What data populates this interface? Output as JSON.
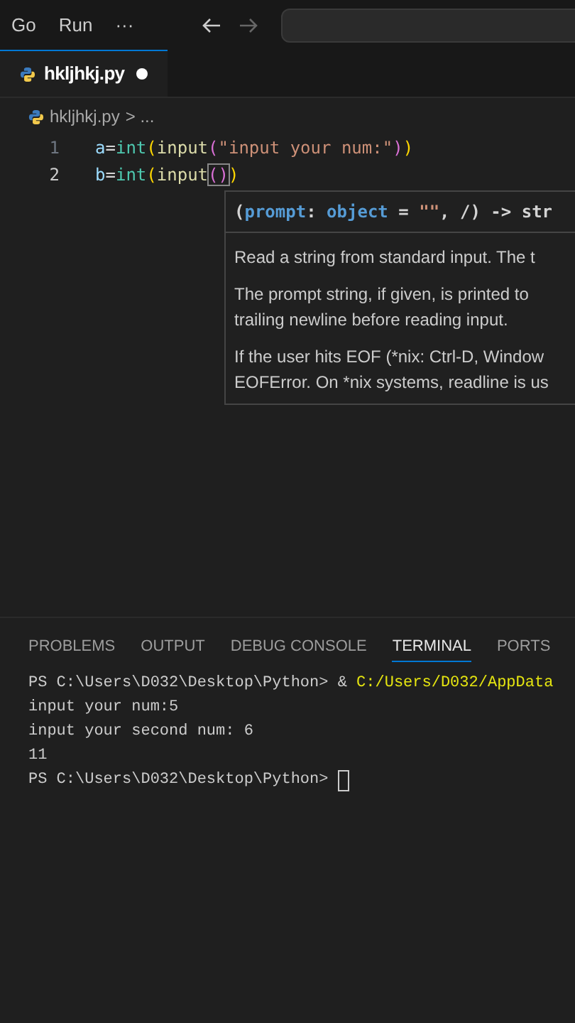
{
  "menu": [
    {
      "label": "Go"
    },
    {
      "label": "Run"
    },
    {
      "label": "···"
    }
  ],
  "tab": {
    "label": "hkljhkj.py",
    "modified": true
  },
  "breadcrumb": {
    "file": "hkljhkj.py",
    "rest": "> ..."
  },
  "code_lines": [
    {
      "number": "1",
      "tokens": [
        {
          "kind": "var",
          "text": "a"
        },
        {
          "kind": "op",
          "text": "="
        },
        {
          "kind": "builtin",
          "text": "int"
        },
        {
          "kind": "paren1",
          "text": "("
        },
        {
          "kind": "func",
          "text": "input"
        },
        {
          "kind": "paren2",
          "text": "("
        },
        {
          "kind": "string",
          "text": "\"input your num:\""
        },
        {
          "kind": "paren2",
          "text": ")"
        },
        {
          "kind": "paren1",
          "text": ")"
        }
      ]
    },
    {
      "number": "2",
      "tokens": [
        {
          "kind": "var",
          "text": "b"
        },
        {
          "kind": "op",
          "text": "="
        },
        {
          "kind": "builtin",
          "text": "int"
        },
        {
          "kind": "paren1",
          "text": "("
        },
        {
          "kind": "func",
          "text": "input"
        },
        {
          "kind": "cursor",
          "text": "()"
        },
        {
          "kind": "paren1",
          "text": ")"
        }
      ]
    }
  ],
  "hover": {
    "signature": [
      {
        "kind": "op",
        "text": "("
      },
      {
        "kind": "param",
        "text": "prompt"
      },
      {
        "kind": "op",
        "text": ": "
      },
      {
        "kind": "param",
        "text": "object"
      },
      {
        "kind": "op",
        "text": " = "
      },
      {
        "kind": "string",
        "text": "\"\""
      },
      {
        "kind": "op",
        "text": ", /) -> str"
      }
    ],
    "paragraphs": [
      "Read a string from standard input. The t",
      "The prompt string, if given, is printed to\ntrailing newline before reading input.",
      "If the user hits EOF (*nix: Ctrl-D, Window\nEOFError. On *nix systems, readline is us"
    ]
  },
  "panel_tabs": [
    {
      "label": "PROBLEMS",
      "selected": false
    },
    {
      "label": "OUTPUT",
      "selected": false
    },
    {
      "label": "DEBUG CONSOLE",
      "selected": false
    },
    {
      "label": "TERMINAL",
      "selected": true
    },
    {
      "label": "PORTS",
      "selected": false
    }
  ],
  "terminal_lines": [
    {
      "tokens": [
        {
          "kind": "plain",
          "text": "PS C:\\Users\\D032\\Desktop\\Python> & "
        },
        {
          "kind": "path",
          "text": "C:/Users/D032/AppData"
        }
      ]
    },
    {
      "tokens": [
        {
          "kind": "plain",
          "text": "input your num:5"
        }
      ]
    },
    {
      "tokens": [
        {
          "kind": "plain",
          "text": "input your second num: 6"
        }
      ]
    },
    {
      "tokens": [
        {
          "kind": "plain",
          "text": "11"
        }
      ]
    },
    {
      "tokens": [
        {
          "kind": "plain",
          "text": "PS C:\\Users\\D032\\Desktop\\Python> "
        }
      ],
      "cursor": true
    }
  ]
}
